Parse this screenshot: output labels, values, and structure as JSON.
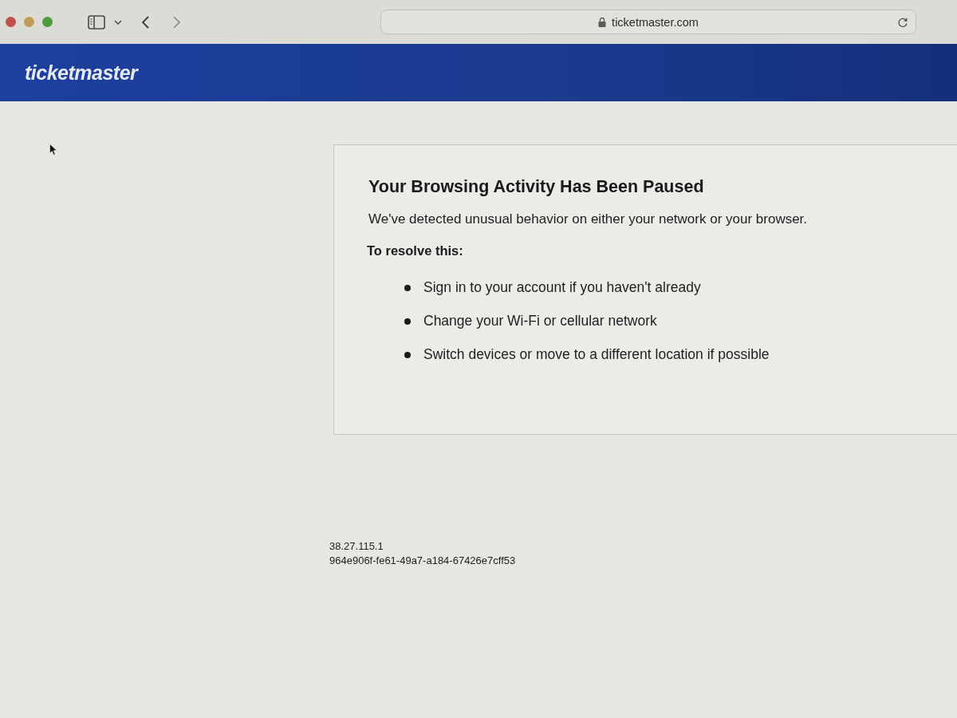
{
  "browser": {
    "address": "ticketmaster.com"
  },
  "header": {
    "logo": "ticketmaster"
  },
  "notice": {
    "title": "Your Browsing Activity Has Been Paused",
    "message": "We've detected unusual behavior on either your network or your browser.",
    "resolve_heading": "To resolve this:",
    "steps": [
      "Sign in to your account if you haven't already",
      "Change your Wi-Fi or cellular network",
      "Switch devices or move to a different location if possible"
    ]
  },
  "footer": {
    "ip_address": "38.27.115.1",
    "reference_id": "964e906f-fe61-49a7-a184-67426e7cff53"
  }
}
